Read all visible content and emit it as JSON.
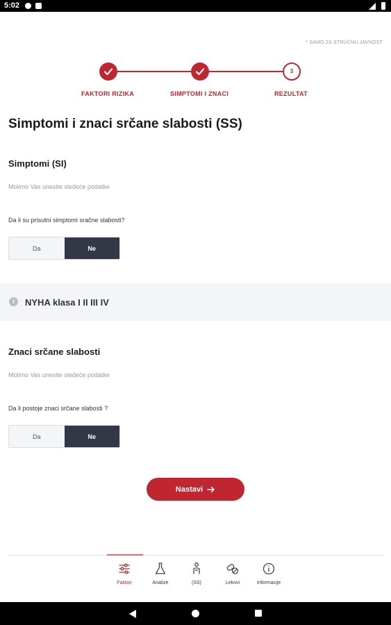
{
  "status_bar": {
    "time": "5:02"
  },
  "note": "* SAMO ZA STRUČNU JAVNOST",
  "stepper": {
    "steps": [
      {
        "label": "FAKTORI RIZIKA",
        "state": "done"
      },
      {
        "label": "SIMPTOMI I ZNACI",
        "state": "done"
      },
      {
        "label": "REZULTAT",
        "state": "pending",
        "number": "3"
      }
    ],
    "accent_color": "#c0262f"
  },
  "page_title": "Simptomi i znaci srčane slabosti (SS)",
  "symptoms": {
    "title": "Simptomi (SI)",
    "hint": "Molimo Vas unesite sledeće podatke",
    "question": "Da li su prisutni simptomi sračne slabosti?",
    "options": [
      "Da",
      "Ne"
    ],
    "selected": "Ne"
  },
  "info_band": {
    "icon": "info-icon",
    "text": "NYHA klasa I II III IV"
  },
  "signs": {
    "title": "Znaci srčane slabosti",
    "hint": "Molimo Vas unesite sledeće podatke",
    "question": "Da li postoje znaci srčane slabosti ?",
    "options": [
      "Da",
      "Ne"
    ],
    "selected": "Ne"
  },
  "next_button": {
    "label": "Nastavi",
    "icon": "arrow-right-icon"
  },
  "bottom_nav": {
    "items": [
      {
        "label": "Faktori",
        "icon": "sliders-icon",
        "active": true
      },
      {
        "label": "Analize",
        "icon": "flask-icon",
        "active": false
      },
      {
        "label": "(SS)",
        "icon": "patient-icon",
        "active": false
      },
      {
        "label": "Lekovi",
        "icon": "pills-icon",
        "active": false
      },
      {
        "label": "Informacije",
        "icon": "info-icon",
        "active": false
      }
    ]
  }
}
